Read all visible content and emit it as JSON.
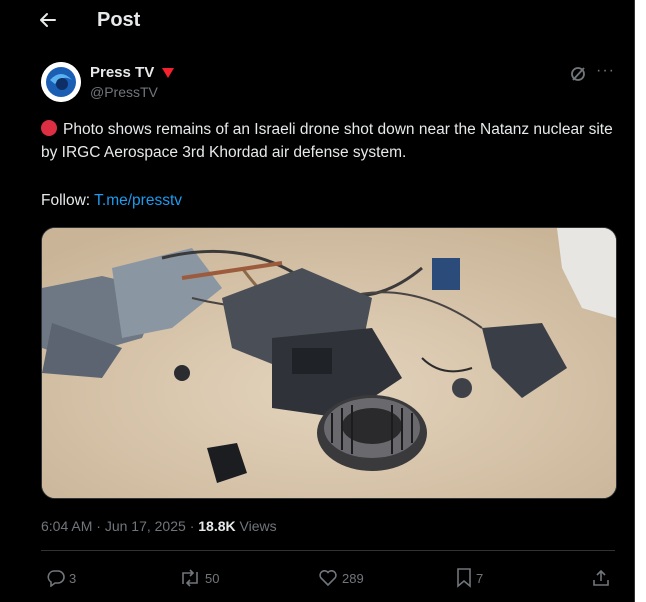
{
  "header": {
    "title": "Post",
    "back_icon": "arrow-left-icon"
  },
  "author": {
    "name": "Press TV",
    "handle": "@PressTV",
    "badge_color": "#f4212e"
  },
  "tweet": {
    "emoji": "red-circle",
    "text": "Photo shows remains of an Israeli drone shot down near the Natanz nuclear site by IRGC Aerospace 3rd Khordad air defense system.",
    "follow_label": "Follow:",
    "follow_link": "T.me/presstv",
    "image_alt": "drone wreckage on sand"
  },
  "meta": {
    "time": "6:04 AM",
    "sep1": "·",
    "date": "Jun 17, 2025",
    "sep2": "·",
    "views_count": "18.8K",
    "views_label": "Views"
  },
  "actions": {
    "replies": "3",
    "reposts": "50",
    "likes": "289",
    "bookmarks": "7"
  },
  "colors": {
    "background": "#000000",
    "text": "#e7e9ea",
    "muted": "#71767b",
    "link": "#1d9bf0"
  }
}
